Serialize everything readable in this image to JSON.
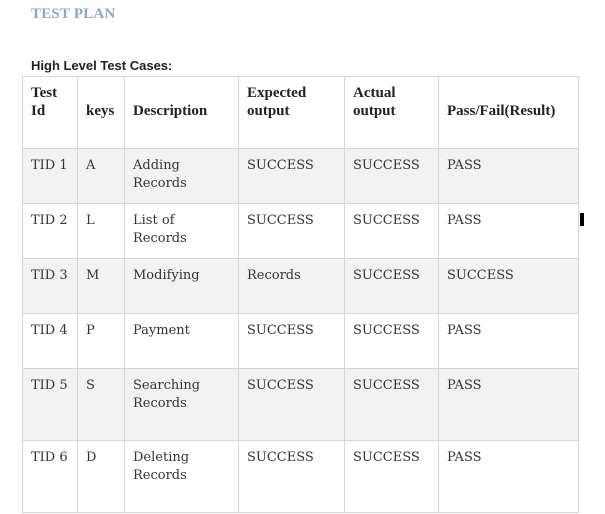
{
  "document": {
    "title": "TEST PLAN",
    "section_heading": "High Level Test Cases:"
  },
  "table": {
    "headers": {
      "test_id": "Test Id",
      "keys": "keys",
      "description": "Description",
      "expected_output": "Expected output",
      "actual_output": "Actual output",
      "result": "Pass/Fail(Result)"
    },
    "rows": [
      {
        "test_id": "TID 1",
        "key": "A",
        "description": "Adding Records",
        "expected": "SUCCESS",
        "actual": "SUCCESS",
        "result": "PASS"
      },
      {
        "test_id": "TID 2",
        "key": "L",
        "description": "List of Records",
        "expected": "SUCCESS",
        "actual": "SUCCESS",
        "result": "PASS"
      },
      {
        "test_id": "TID 3",
        "key": "M",
        "description": "Modifying",
        "expected": "Records",
        "actual": "SUCCESS",
        "result": "SUCCESS"
      },
      {
        "test_id": "TID 4",
        "key": "P",
        "description": "Payment",
        "expected": "SUCCESS",
        "actual": "SUCCESS",
        "result": "PASS"
      },
      {
        "test_id": "TID 5",
        "key": "S",
        "description": "Searching Records",
        "expected": "SUCCESS",
        "actual": "SUCCESS",
        "result": "PASS"
      },
      {
        "test_id": "TID 6",
        "key": "D",
        "description": "Deleting Records",
        "expected": "SUCCESS",
        "actual": "SUCCESS",
        "result": "PASS"
      }
    ]
  },
  "colors": {
    "title": "#8fa5c0",
    "row_shade": "#f2f2f2",
    "border": "#d6d6d6"
  }
}
